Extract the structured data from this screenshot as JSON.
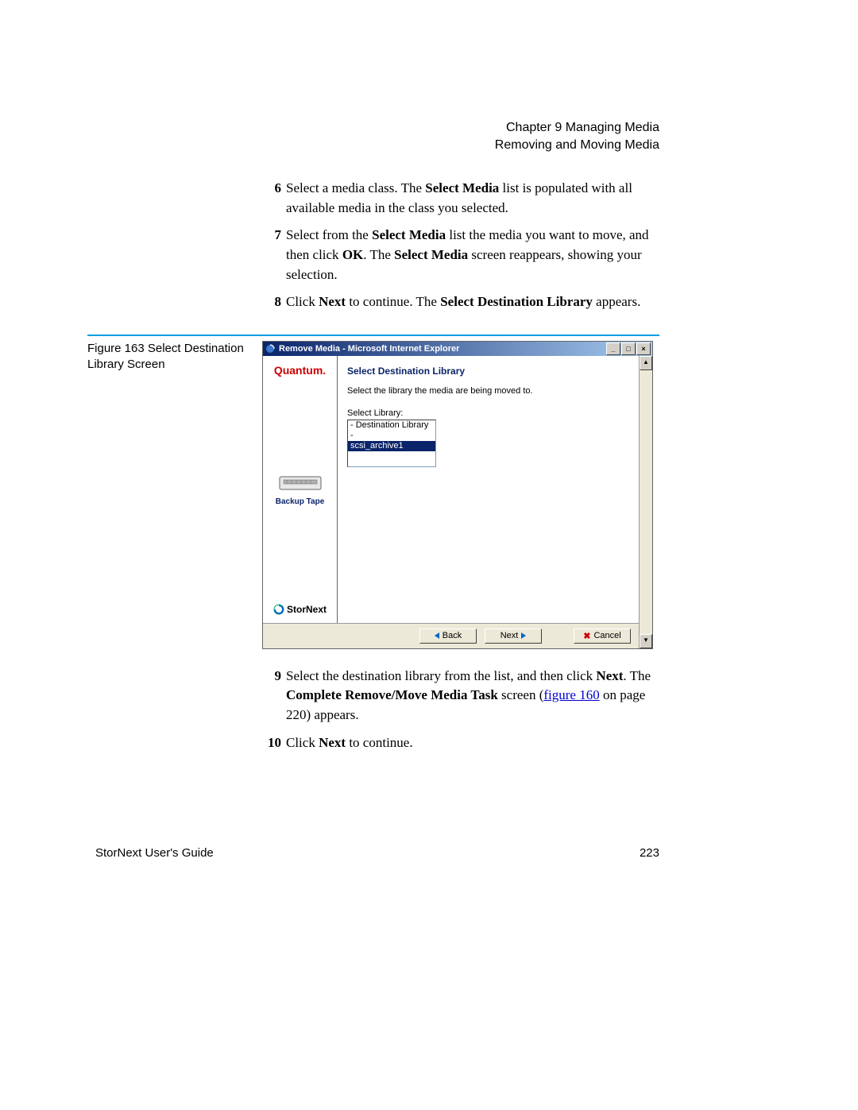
{
  "header": {
    "chapter": "Chapter 9  Managing Media",
    "section": "Removing and Moving Media"
  },
  "steps_top": [
    {
      "num": "6",
      "parts": [
        "Select a media class. The ",
        "Select Media",
        " list is populated with all available media in the class you selected."
      ]
    },
    {
      "num": "7",
      "parts": [
        "Select from the ",
        "Select Media",
        " list the media you want to move, and then click ",
        "OK",
        ". The ",
        "Select Media",
        " screen reappears, showing your selection."
      ]
    },
    {
      "num": "8",
      "parts": [
        "Click ",
        "Next",
        " to continue. The ",
        "Select Destination Library",
        " appears."
      ]
    }
  ],
  "figure_caption": "Figure 163  Select Destination Library Screen",
  "dialog": {
    "title": "Remove Media - Microsoft Internet Explorer",
    "panel_title": "Select Destination Library",
    "panel_desc": "Select the library the media are being moved to.",
    "select_label": "Select Library:",
    "options": [
      "- Destination Library -",
      "scsi_archive1"
    ],
    "selected_index": 1,
    "logo": "Quantum.",
    "backup_tape": "Backup Tape",
    "stornext": "StorNext",
    "buttons": {
      "back": "Back",
      "next": "Next",
      "cancel": "Cancel"
    }
  },
  "steps_bottom": [
    {
      "num": "9",
      "pre": "Select the destination library from the list, and then click ",
      "b1": "Next",
      "mid1": ". The ",
      "b2": "Complete Remove/Move Media Task",
      "mid2": " screen (",
      "link": "figure 160",
      "post": " on page 220) appears."
    },
    {
      "num": "10",
      "pre": "Click ",
      "b1": "Next",
      "post": " to continue."
    }
  ],
  "footer": {
    "guide": "StorNext User's Guide",
    "page": "223"
  }
}
